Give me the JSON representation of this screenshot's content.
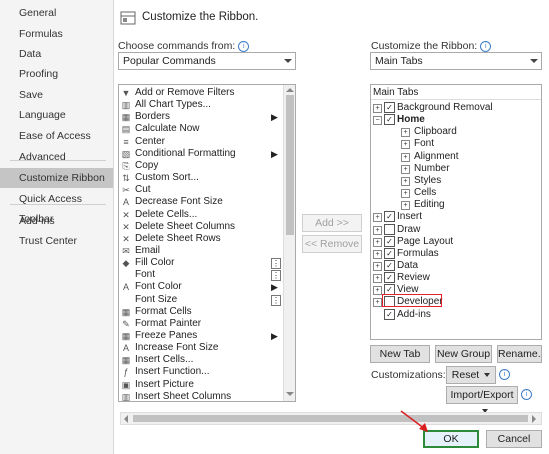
{
  "nav": {
    "items": [
      {
        "label": "General",
        "active": false
      },
      {
        "label": "Formulas",
        "active": false
      },
      {
        "label": "Data",
        "active": false
      },
      {
        "label": "Proofing",
        "active": false
      },
      {
        "label": "Save",
        "active": false
      },
      {
        "label": "Language",
        "active": false
      },
      {
        "label": "Ease of Access",
        "active": false
      },
      {
        "label": "Advanced",
        "active": false
      },
      {
        "label": "Customize Ribbon",
        "active": true
      },
      {
        "label": "Quick Access Toolbar",
        "active": false
      },
      {
        "label": "Add-ins",
        "active": false
      },
      {
        "label": "Trust Center",
        "active": false
      }
    ]
  },
  "header": {
    "title": "Customize the Ribbon."
  },
  "left": {
    "label": "Choose commands from:",
    "select_value": "Popular Commands",
    "commands": [
      {
        "label": "Add or Remove Filters",
        "icon": "▼",
        "marker": ""
      },
      {
        "label": "All Chart Types...",
        "icon": "▥",
        "marker": ""
      },
      {
        "label": "Borders",
        "icon": "▦",
        "marker": "▶"
      },
      {
        "label": "Calculate Now",
        "icon": "▤",
        "marker": ""
      },
      {
        "label": "Center",
        "icon": "≡",
        "marker": ""
      },
      {
        "label": "Conditional Formatting",
        "icon": "▧",
        "marker": "▶"
      },
      {
        "label": "Copy",
        "icon": "⎘",
        "marker": ""
      },
      {
        "label": "Custom Sort...",
        "icon": "⇅",
        "marker": ""
      },
      {
        "label": "Cut",
        "icon": "✂",
        "marker": ""
      },
      {
        "label": "Decrease Font Size",
        "icon": "A",
        "marker": ""
      },
      {
        "label": "Delete Cells...",
        "icon": "✕",
        "marker": ""
      },
      {
        "label": "Delete Sheet Columns",
        "icon": "✕",
        "marker": ""
      },
      {
        "label": "Delete Sheet Rows",
        "icon": "✕",
        "marker": ""
      },
      {
        "label": "Email",
        "icon": "✉",
        "marker": ""
      },
      {
        "label": "Fill Color",
        "icon": "◆",
        "marker": "box"
      },
      {
        "label": "Font",
        "icon": "",
        "marker": "box"
      },
      {
        "label": "Font Color",
        "icon": "A",
        "marker": "▶"
      },
      {
        "label": "Font Size",
        "icon": "",
        "marker": "box"
      },
      {
        "label": "Format Cells",
        "icon": "▦",
        "marker": ""
      },
      {
        "label": "Format Painter",
        "icon": "✎",
        "marker": ""
      },
      {
        "label": "Freeze Panes",
        "icon": "▦",
        "marker": "▶"
      },
      {
        "label": "Increase Font Size",
        "icon": "A",
        "marker": ""
      },
      {
        "label": "Insert Cells...",
        "icon": "▦",
        "marker": ""
      },
      {
        "label": "Insert Function...",
        "icon": "ƒ",
        "marker": ""
      },
      {
        "label": "Insert Picture",
        "icon": "▣",
        "marker": ""
      },
      {
        "label": "Insert Sheet Columns",
        "icon": "▥",
        "marker": ""
      }
    ]
  },
  "middle": {
    "add_label": "Add >>",
    "remove_label": "<< Remove"
  },
  "right": {
    "label": "Customize the Ribbon:",
    "select_value": "Main Tabs",
    "section_header": "Main Tabs",
    "tree": [
      {
        "label": "Background Removal",
        "level": 0,
        "expander": "+",
        "checked": true,
        "bold": false
      },
      {
        "label": "Home",
        "level": 0,
        "expander": "−",
        "checked": true,
        "bold": true
      },
      {
        "label": "Clipboard",
        "level": 1,
        "expander": "+",
        "checked": null,
        "bold": false
      },
      {
        "label": "Font",
        "level": 1,
        "expander": "+",
        "checked": null,
        "bold": false
      },
      {
        "label": "Alignment",
        "level": 1,
        "expander": "+",
        "checked": null,
        "bold": false
      },
      {
        "label": "Number",
        "level": 1,
        "expander": "+",
        "checked": null,
        "bold": false
      },
      {
        "label": "Styles",
        "level": 1,
        "expander": "+",
        "checked": null,
        "bold": false
      },
      {
        "label": "Cells",
        "level": 1,
        "expander": "+",
        "checked": null,
        "bold": false
      },
      {
        "label": "Editing",
        "level": 1,
        "expander": "+",
        "checked": null,
        "bold": false
      },
      {
        "label": "Insert",
        "level": 0,
        "expander": "+",
        "checked": true,
        "bold": false
      },
      {
        "label": "Draw",
        "level": 0,
        "expander": "+",
        "checked": false,
        "bold": false
      },
      {
        "label": "Page Layout",
        "level": 0,
        "expander": "+",
        "checked": true,
        "bold": false
      },
      {
        "label": "Formulas",
        "level": 0,
        "expander": "+",
        "checked": true,
        "bold": false
      },
      {
        "label": "Data",
        "level": 0,
        "expander": "+",
        "checked": true,
        "bold": false
      },
      {
        "label": "Review",
        "level": 0,
        "expander": "+",
        "checked": true,
        "bold": false
      },
      {
        "label": "View",
        "level": 0,
        "expander": "+",
        "checked": true,
        "bold": false
      },
      {
        "label": "Developer",
        "level": 0,
        "expander": "+",
        "checked": false,
        "bold": false,
        "highlight": true
      },
      {
        "label": "Add-ins",
        "level": 0,
        "expander": "",
        "checked": true,
        "bold": false
      }
    ],
    "new_tab_label": "New Tab",
    "new_group_label": "New Group",
    "rename_label": "Rename...",
    "customizations_label": "Customizations:",
    "reset_label": "Reset",
    "import_export_label": "Import/Export"
  },
  "footer": {
    "ok_label": "OK",
    "cancel_label": "Cancel"
  },
  "colors": {
    "highlight": "#e8202a",
    "ok_border": "#2e8b3a",
    "annotation_arrow": "#d92020",
    "info": "#3d7cc9"
  }
}
